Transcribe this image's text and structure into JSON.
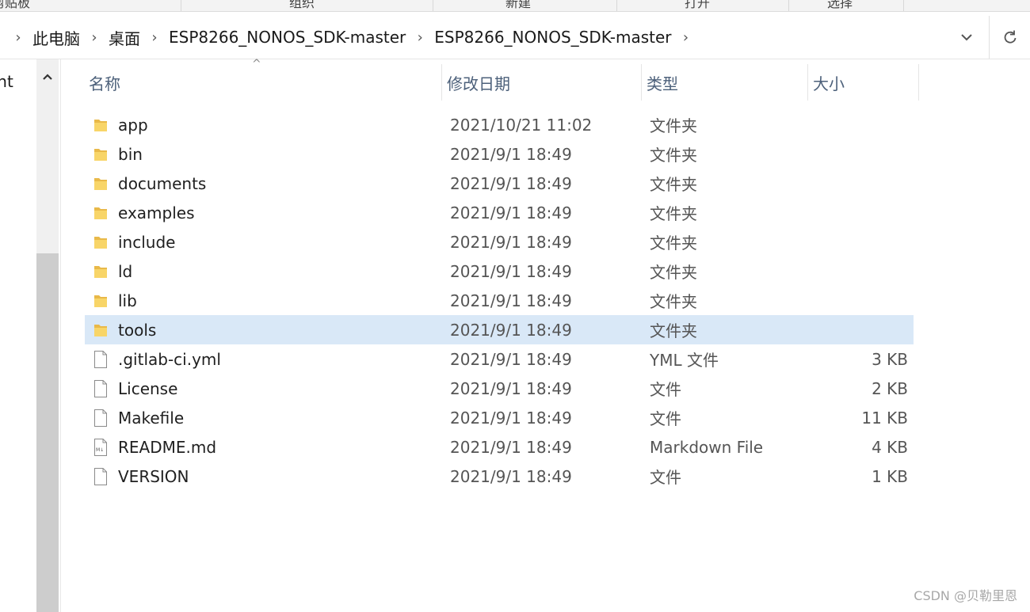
{
  "ribbon": {
    "groups": [
      "剪贴板",
      "组织",
      "新建",
      "打开",
      "选择"
    ]
  },
  "address": {
    "crumbs": [
      "此电脑",
      "桌面",
      "ESP8266_NONOS_SDK-master",
      "ESP8266_NONOS_SDK-master"
    ],
    "separator": "›"
  },
  "nav": {
    "partial_item": "ent"
  },
  "columns": {
    "name": "名称",
    "date": "修改日期",
    "type": "类型",
    "size": "大小"
  },
  "files": [
    {
      "name": "app",
      "date": "2021/10/21 11:02",
      "type": "文件夹",
      "size": "",
      "icon": "folder-icon"
    },
    {
      "name": "bin",
      "date": "2021/9/1 18:49",
      "type": "文件夹",
      "size": "",
      "icon": "folder-icon"
    },
    {
      "name": "documents",
      "date": "2021/9/1 18:49",
      "type": "文件夹",
      "size": "",
      "icon": "folder-icon"
    },
    {
      "name": "examples",
      "date": "2021/9/1 18:49",
      "type": "文件夹",
      "size": "",
      "icon": "folder-icon"
    },
    {
      "name": "include",
      "date": "2021/9/1 18:49",
      "type": "文件夹",
      "size": "",
      "icon": "folder-icon"
    },
    {
      "name": "ld",
      "date": "2021/9/1 18:49",
      "type": "文件夹",
      "size": "",
      "icon": "folder-icon"
    },
    {
      "name": "lib",
      "date": "2021/9/1 18:49",
      "type": "文件夹",
      "size": "",
      "icon": "folder-icon"
    },
    {
      "name": "tools",
      "date": "2021/9/1 18:49",
      "type": "文件夹",
      "size": "",
      "icon": "folder-icon",
      "selected": true
    },
    {
      "name": ".gitlab-ci.yml",
      "date": "2021/9/1 18:49",
      "type": "YML 文件",
      "size": "3 KB",
      "icon": "file-icon"
    },
    {
      "name": "License",
      "date": "2021/9/1 18:49",
      "type": "文件",
      "size": "2 KB",
      "icon": "file-icon"
    },
    {
      "name": "Makefile",
      "date": "2021/9/1 18:49",
      "type": "文件",
      "size": "11 KB",
      "icon": "file-icon"
    },
    {
      "name": "README.md",
      "date": "2021/9/1 18:49",
      "type": "Markdown File",
      "size": "4 KB",
      "icon": "markdown-file-icon"
    },
    {
      "name": "VERSION",
      "date": "2021/9/1 18:49",
      "type": "文件",
      "size": "1 KB",
      "icon": "file-icon"
    }
  ],
  "colors": {
    "selected_row": "#d9e8f7",
    "folder": "#f8d568",
    "header_text": "#4c607a"
  },
  "watermark": "CSDN @贝勒里恩"
}
